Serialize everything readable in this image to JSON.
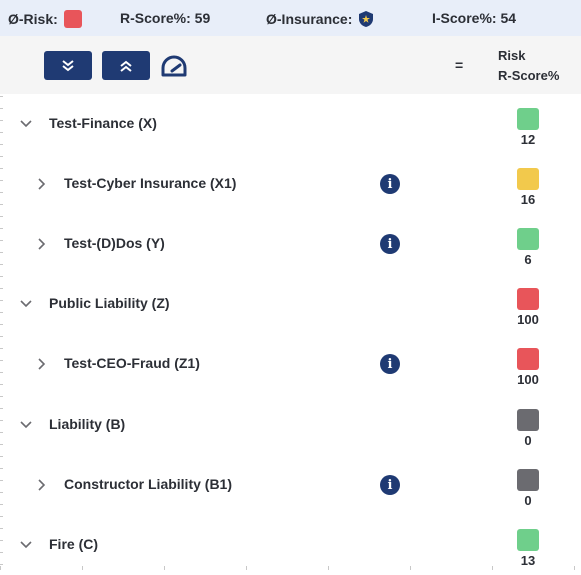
{
  "topbar": {
    "risk_label": "Ø-Risk:",
    "risk_color": "#e8555a",
    "rscore_label": "R-Score%: 59",
    "insurance_label": "Ø-Insurance:",
    "insurance_icon": "shield-icon",
    "iscore_label": "I-Score%: 54"
  },
  "toolbar": {
    "collapse_icon": "double-chevron-down-icon",
    "expand_icon": "double-chevron-up-icon",
    "gauge_icon": "gauge-icon",
    "equals_label": "=",
    "risk_header_line1": "Risk",
    "risk_header_line2": "R-Score%"
  },
  "colors": {
    "green": "#6fcf8b",
    "yellow": "#f2c94c",
    "red": "#e8555a",
    "gray": "#6b6b70",
    "navy": "#1f3a73"
  },
  "rows": [
    {
      "label": "Test-Finance (X)",
      "level": 0,
      "expanded": true,
      "info": false,
      "color": "#6fcf8b",
      "score": "12"
    },
    {
      "label": "Test-Cyber Insurance (X1)",
      "level": 1,
      "expanded": false,
      "info": true,
      "color": "#f2c94c",
      "score": "16"
    },
    {
      "label": "Test-(D)Dos (Y)",
      "level": 1,
      "expanded": false,
      "info": true,
      "color": "#6fcf8b",
      "score": "6"
    },
    {
      "label": "Public Liability (Z)",
      "level": 0,
      "expanded": true,
      "info": false,
      "color": "#e8555a",
      "score": "100"
    },
    {
      "label": "Test-CEO-Fraud (Z1)",
      "level": 1,
      "expanded": false,
      "info": true,
      "color": "#e8555a",
      "score": "100"
    },
    {
      "label": "Liability (B)",
      "level": 0,
      "expanded": true,
      "info": false,
      "color": "#6b6b70",
      "score": "0"
    },
    {
      "label": "Constructor Liability (B1)",
      "level": 1,
      "expanded": false,
      "info": true,
      "color": "#6b6b70",
      "score": "0"
    },
    {
      "label": "Fire (C)",
      "level": 0,
      "expanded": true,
      "info": false,
      "color": "#6fcf8b",
      "score": "13"
    }
  ],
  "info_glyph": "i"
}
